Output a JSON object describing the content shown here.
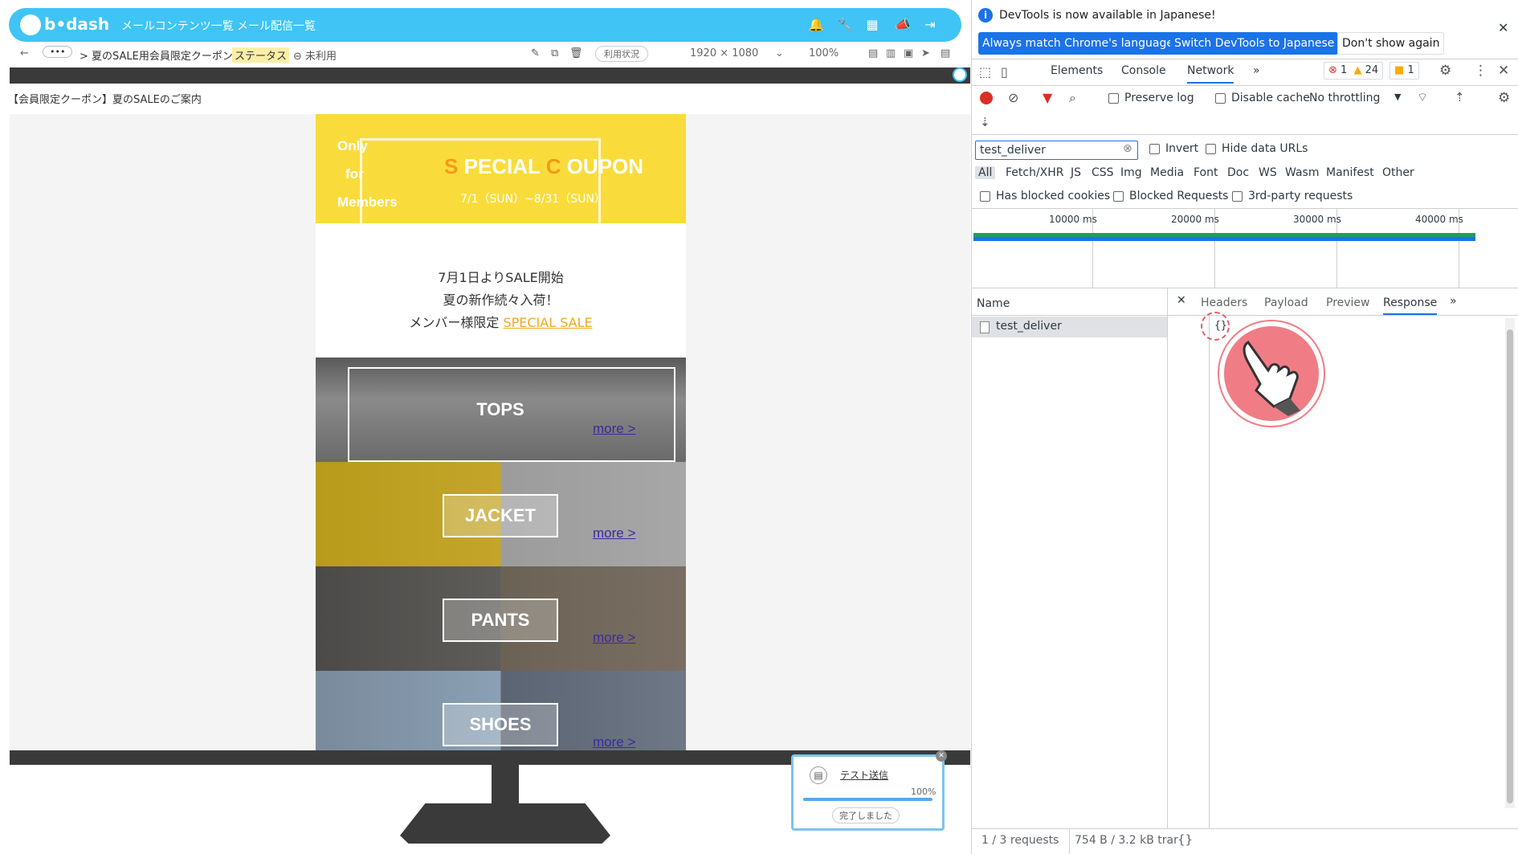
{
  "app": {
    "logo_text": "b•dash",
    "nav": [
      "メールコンテンツ一覧",
      "メール配信一覧"
    ],
    "subbar": {
      "ellipsis": "•••",
      "breadcrumb": "> 夏のSALE用会員限定クーポン",
      "status_label": "ステータス",
      "status_value": "未利用",
      "usage_button": "利用状況",
      "resolution": "1920 × 1080",
      "zoom": "100%"
    },
    "page_title": "【会員限定クーポン】夏のSALEのご案内",
    "email": {
      "coupon_only": [
        "Only",
        "for",
        "Members"
      ],
      "coupon_title_s": "S",
      "coupon_title_1": "PECIAL",
      "coupon_title_c": "C",
      "coupon_title_2": "OUPON",
      "coupon_dates": "7/1（SUN）~8/31（SUN）",
      "intro_line1": "7月1日よりSALE開始",
      "intro_line2": "夏の新作続々入荷！",
      "intro_line3_prefix": "メンバー様限定",
      "intro_line3_link": "SPECIAL SALE",
      "categories": [
        {
          "label": "TOPS",
          "more": "more >"
        },
        {
          "label": "JACKET",
          "more": "more >"
        },
        {
          "label": "PANTS",
          "more": "more >"
        },
        {
          "label": "SHOES",
          "more": "more >"
        }
      ]
    },
    "toast": {
      "title": "テスト送信",
      "percent": "100%",
      "progress": 1.0,
      "status": "完了しました"
    }
  },
  "devtools": {
    "info_banner": "DevTools is now available in Japanese!",
    "btn_match": "Always match Chrome's language",
    "btn_switch": "Switch DevTools to Japanese",
    "btn_dont_show": "Don't show again",
    "tabs": [
      "Elements",
      "Console",
      "Network"
    ],
    "active_tab": "Network",
    "errors": "1",
    "warnings": "24",
    "issues": "1",
    "preserve_log": "Preserve log",
    "disable_cache": "Disable cache",
    "throttling": "No throttling",
    "filter_value": "test_deliver",
    "invert": "Invert",
    "hide_data_urls": "Hide data URLs",
    "types": [
      "All",
      "Fetch/XHR",
      "JS",
      "CSS",
      "Img",
      "Media",
      "Font",
      "Doc",
      "WS",
      "Wasm",
      "Manifest",
      "Other"
    ],
    "blocked_cookies": "Has blocked cookies",
    "blocked_requests": "Blocked Requests",
    "third_party": "3rd-party requests",
    "timeline_ticks": [
      "10000 ms",
      "20000 ms",
      "30000 ms",
      "40000 ms"
    ],
    "name_header": "Name",
    "request_name": "test_deliver",
    "detail_tabs": [
      "Headers",
      "Payload",
      "Preview",
      "Response"
    ],
    "active_detail_tab": "Response",
    "response_body": "{}",
    "status_requests": "1 / 3 requests",
    "status_transfer": "754 B / 3.2 kB trar",
    "status_format": "{}"
  }
}
